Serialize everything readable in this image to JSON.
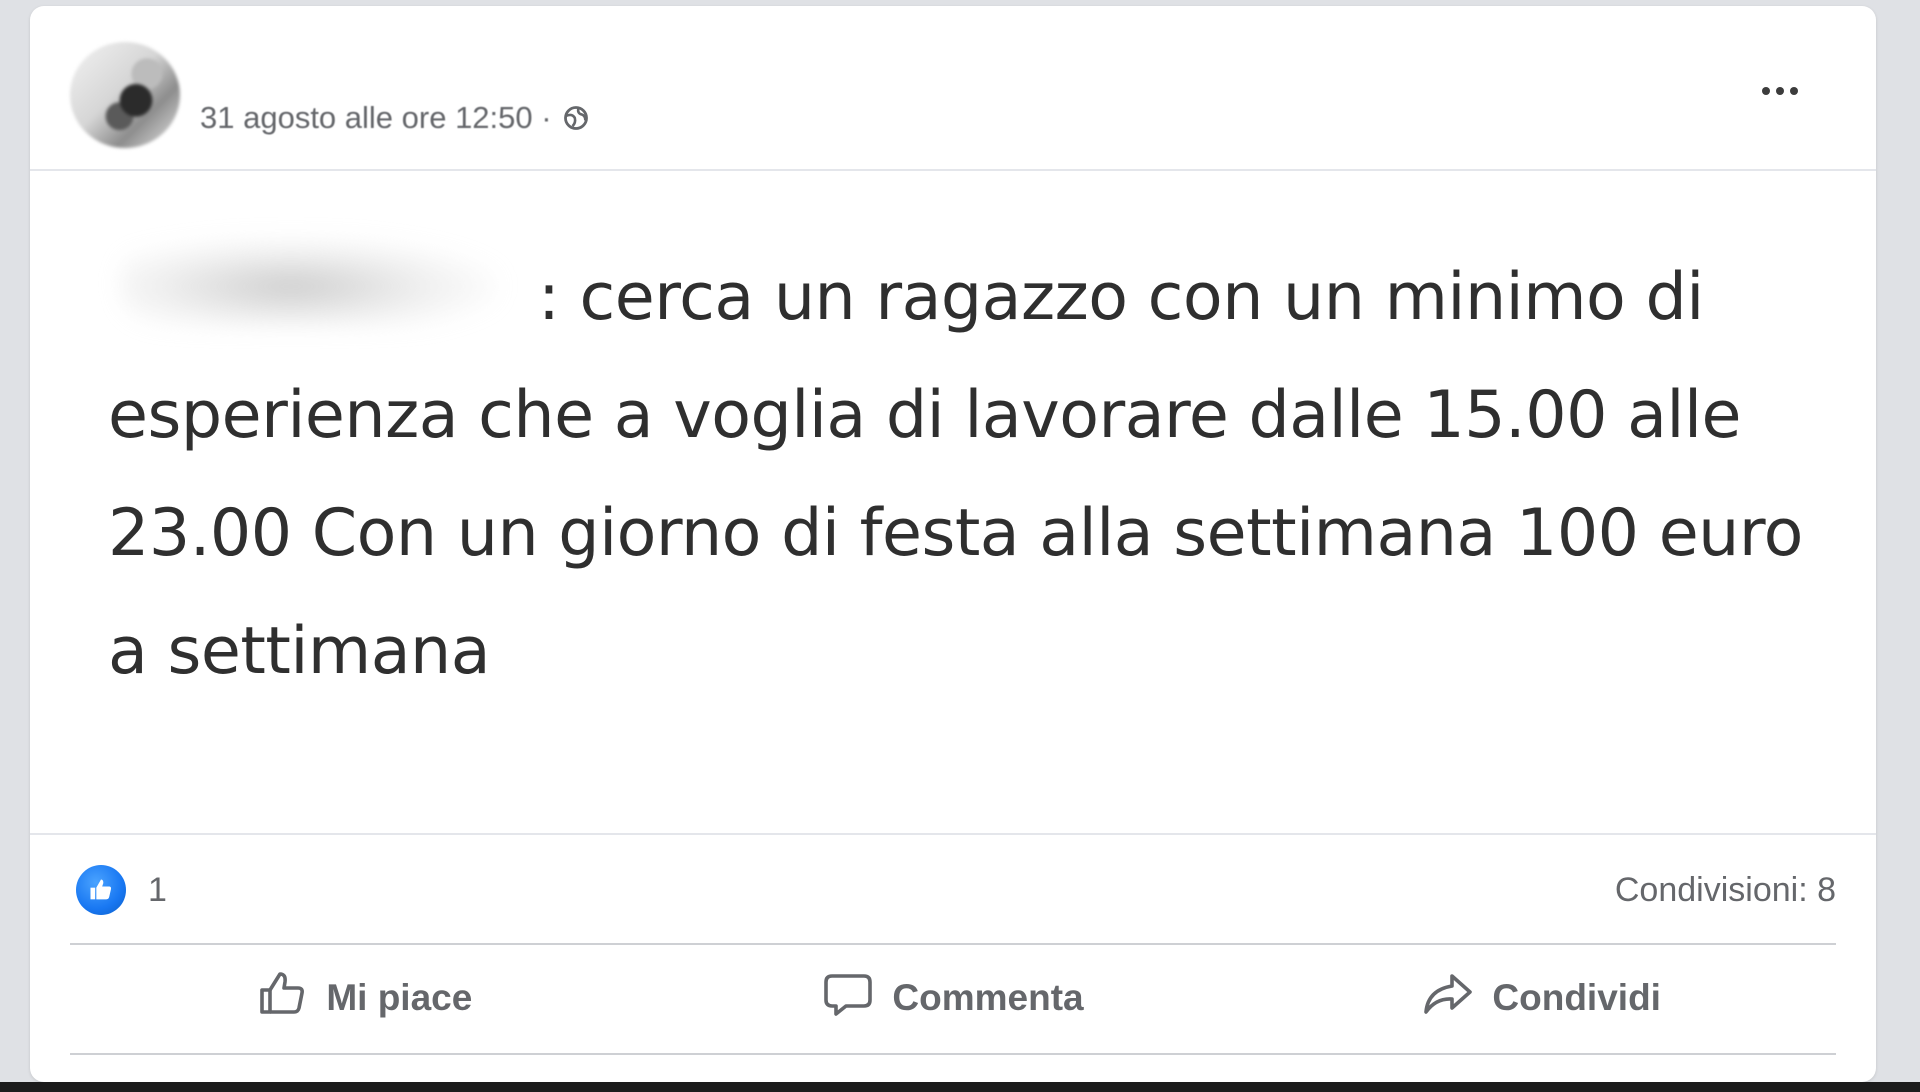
{
  "post": {
    "timestamp": "31 agosto alle ore 12:50 ·",
    "body_text": ": cerca un ragazzo con un minimo di esperienza che a voglia di lavorare dalle 15.00 alle 23.00 Con un giorno di festa alla settimana 100 euro a settimana",
    "author_redacted": true
  },
  "stats": {
    "like_count": "1",
    "shares": "Condivisioni: 8"
  },
  "actions": {
    "like_label": "Mi piace",
    "comment_label": "Commenta",
    "share_label": "Condividi"
  },
  "icons": {
    "privacy": "globe-icon",
    "menu": "more-options-icon",
    "reaction": "like-reaction-icon",
    "like": "thumbs-up-icon",
    "comment": "comment-bubble-icon",
    "share": "share-arrow-icon"
  },
  "colors": {
    "accent": "#1877f2",
    "secondary_text": "#65676b",
    "body_text": "#2f2f2f",
    "background": "#dfe1e5"
  }
}
